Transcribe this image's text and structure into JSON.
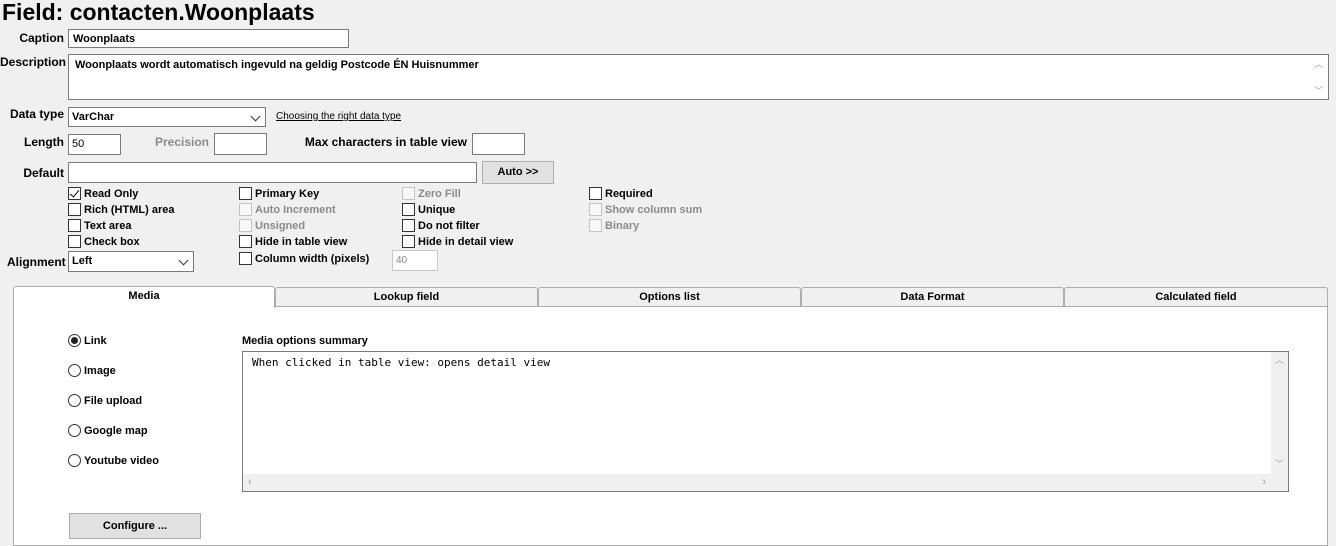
{
  "title": "Field: contacten.Woonplaats",
  "caption": {
    "label": "Caption",
    "value": "Woonplaats"
  },
  "description": {
    "label": "Description",
    "value": "Woonplaats wordt automatisch ingevuld na geldig Postcode ÉN Huisnummer"
  },
  "data_type": {
    "label": "Data type",
    "value": "VarChar",
    "help_link": "Choosing the right data type"
  },
  "length": {
    "label": "Length",
    "value": "50"
  },
  "precision": {
    "label": "Precision",
    "value": ""
  },
  "max_chars": {
    "label": "Max characters in table view",
    "value": ""
  },
  "default": {
    "label": "Default",
    "value": "",
    "auto_button": "Auto >>"
  },
  "checkboxes": {
    "read_only": "Read Only",
    "rich_html": "Rich (HTML) area",
    "text_area": "Text area",
    "check_box": "Check box",
    "primary_key": "Primary Key",
    "auto_increment": "Auto Increment",
    "unsigned": "Unsigned",
    "hide_table": "Hide in table view",
    "column_width": "Column width (pixels)",
    "zero_fill": "Zero Fill",
    "unique": "Unique",
    "do_not_filter": "Do not filter",
    "hide_detail": "Hide in detail view",
    "required": "Required",
    "show_column_sum": "Show column sum",
    "binary": "Binary"
  },
  "column_width_value": "40",
  "alignment": {
    "label": "Alignment",
    "value": "Left"
  },
  "tabs": {
    "media": "Media",
    "lookup": "Lookup field",
    "options": "Options list",
    "format": "Data Format",
    "calculated": "Calculated field"
  },
  "media": {
    "options": [
      "Link",
      "Image",
      "File upload",
      "Google map",
      "Youtube video"
    ],
    "selected": "Link",
    "summary_label": "Media options summary",
    "summary_text": "When clicked in table view: opens detail view",
    "configure_button": "Configure ..."
  }
}
